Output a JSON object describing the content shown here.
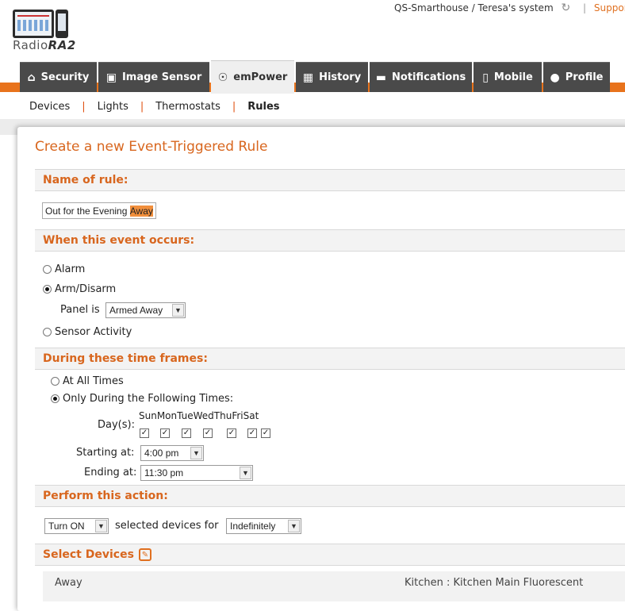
{
  "logo": {
    "text_prefix": "Radio",
    "text_brand": "RA2"
  },
  "account": {
    "system_label": "QS-Smarthouse / Teresa's system",
    "refresh_icon": "refresh-icon",
    "support_label": "Support C"
  },
  "nav": {
    "tabs": [
      {
        "label": "Security",
        "icon": "home-icon"
      },
      {
        "label": "Image Sensor",
        "icon": "camera-icon"
      },
      {
        "label": "emPower",
        "icon": "lightbulb-icon",
        "active": true
      },
      {
        "label": "History",
        "icon": "calendar-icon"
      },
      {
        "label": "Notifications",
        "icon": "speech-bubble-icon"
      },
      {
        "label": "Mobile",
        "icon": "phone-icon"
      },
      {
        "label": "Profile",
        "icon": "user-icon"
      }
    ]
  },
  "subnav": {
    "items": [
      {
        "label": "Devices"
      },
      {
        "label": "Lights"
      },
      {
        "label": "Thermostats"
      },
      {
        "label": "Rules",
        "active": true
      }
    ]
  },
  "page": {
    "title": "Create a new Event-Triggered Rule"
  },
  "name_section": {
    "heading": "Name of rule:",
    "value_main": "Out for the Evening ",
    "value_highlight": "Away"
  },
  "event_section": {
    "heading": "When this event occurs:",
    "options": [
      {
        "label": "Alarm",
        "selected": false
      },
      {
        "label": "Arm/Disarm",
        "selected": true
      },
      {
        "label": "Sensor Activity",
        "selected": false
      }
    ],
    "panel_label": "Panel is",
    "panel_value": "Armed Away"
  },
  "time_section": {
    "heading": "During these time frames:",
    "options": [
      {
        "label": "At All Times",
        "selected": false
      },
      {
        "label": "Only During the Following Times:",
        "selected": true
      }
    ],
    "days_label": "Day(s):",
    "days_header": "SunMonTueWedThuFriSat",
    "days": [
      {
        "name": "Sun",
        "checked": true
      },
      {
        "name": "Mon",
        "checked": true
      },
      {
        "name": "Tue",
        "checked": true
      },
      {
        "name": "Wed",
        "checked": true
      },
      {
        "name": "Thu",
        "checked": true
      },
      {
        "name": "Fri",
        "checked": true
      },
      {
        "name": "Sat",
        "checked": true
      }
    ],
    "start_label": "Starting at:",
    "start_value": "4:00 pm",
    "end_label": "Ending at:",
    "end_value": "11:30 pm"
  },
  "action_section": {
    "heading": "Perform this action:",
    "action_value": "Turn ON",
    "middle_text": "selected devices for",
    "duration_value": "Indefinitely"
  },
  "devices_section": {
    "heading": "Select Devices",
    "edit_icon": "edit-icon",
    "row_left": "Away",
    "row_right": "Kitchen : Kitchen Main Fluorescent"
  },
  "colors": {
    "accent_orange": "#e8731c",
    "heading_orange": "#d8661e",
    "tab_dark": "#4a4a4a",
    "tab_active": "#efefef",
    "highlight": "#f18f3c"
  }
}
